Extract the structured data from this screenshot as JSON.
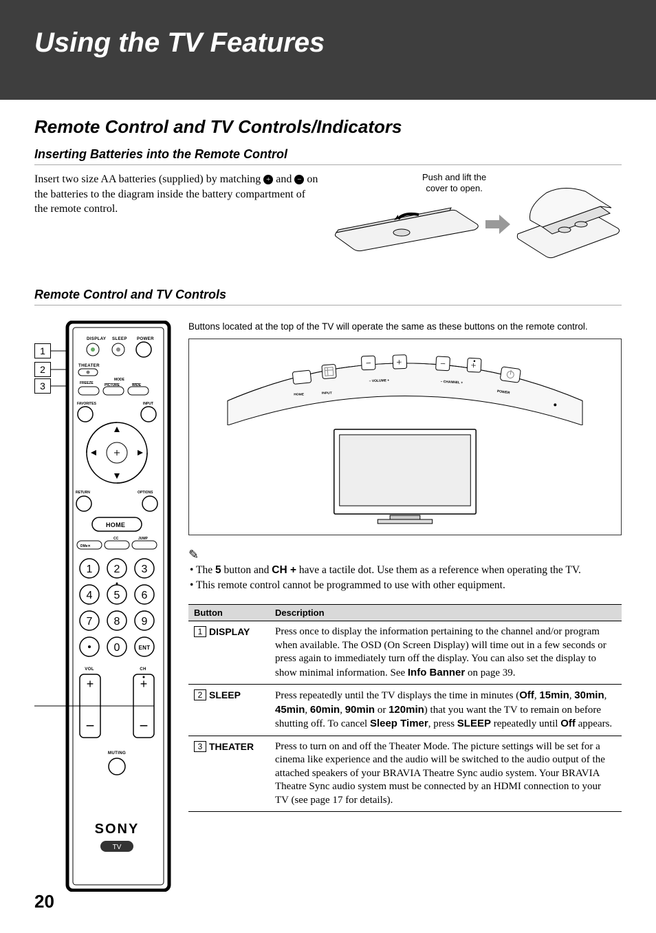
{
  "chapter_title": "Using the TV Features",
  "section_heading": "Remote Control and TV Controls/Indicators",
  "sub1_heading": "Inserting Batteries into the Remote Control",
  "intro_text_pre": "Insert two size AA batteries (supplied) by matching ",
  "intro_text_mid": " and ",
  "intro_text_post": " on the batteries to the diagram inside the battery compartment of the remote control.",
  "battery_caption_line1": "Push and lift the",
  "battery_caption_line2": "cover to open.",
  "sub2_heading": "Remote Control and TV Controls",
  "tv_note": "Buttons located at the top of the TV will operate the same as these buttons on the remote control.",
  "tv_labels": {
    "home": "HOME",
    "input": "INPUT",
    "volume": "– VOLUME +",
    "channel": "– CHANNEL +",
    "power": "POWER"
  },
  "note1_pre": "The ",
  "note1_b1": "5",
  "note1_mid": " button and ",
  "note1_b2": "CH +",
  "note1_post": " have a tactile dot. Use them as a reference when operating the TV.",
  "note2": "This remote control cannot be programmed to use with other equipment.",
  "table": {
    "header_button": "Button",
    "header_desc": "Description",
    "rows": [
      {
        "num": "1",
        "name": "DISPLAY",
        "desc_pre": "Press once to display the information pertaining to the channel and/or program when available. The OSD (On Screen Display) will time out in a few seconds or press again to immediately turn off the display. You can also set the display to show minimal information. See ",
        "desc_b1": "Info Banner",
        "desc_post": " on page 39."
      },
      {
        "num": "2",
        "name": "SLEEP",
        "desc_pre": "Press repeatedly until the TV displays the time in minutes (",
        "desc_b1": "Off",
        "s1": ", ",
        "desc_b2": "15min",
        "s2": ", ",
        "desc_b3": "30min",
        "s3": ", ",
        "desc_b4": "45min",
        "s4": ", ",
        "desc_b5": "60min",
        "s5": ", ",
        "desc_b6": "90min",
        "s6": " or ",
        "desc_b7": "120min",
        "desc_mid": ") that you want the TV to remain on before shutting off. To cancel ",
        "desc_b8": "Sleep Timer",
        "s7": ", press ",
        "desc_b9": "SLEEP",
        "s8": " repeatedly until ",
        "desc_b10": "Off",
        "desc_post": " appears."
      },
      {
        "num": "3",
        "name": "THEATER",
        "desc": "Press to turn on and off the Theater Mode. The picture settings will be set for a cinema like experience and the audio will be switched to the audio output of the attached speakers of your BRAVIA Theatre Sync audio system. Your BRAVIA Theatre Sync audio system must be connected by an HDMI connection to your TV (see page 17 for details)."
      }
    ]
  },
  "remote_labels": {
    "display": "DISPLAY",
    "sleep": "SLEEP",
    "power": "POWER",
    "theater": "THEATER",
    "freeze": "FREEZE",
    "mode": "MODE",
    "picture": "PICTURE",
    "wide": "WIDE",
    "favorites": "FAVORITES",
    "input": "INPUT",
    "return": "RETURN",
    "options": "OPTIONS",
    "home": "HOME",
    "dmex": "DMe✕",
    "cc": "CC",
    "jump": "JUMP",
    "vol": "VOL",
    "ch": "CH",
    "muting": "MUTING",
    "ent": "ENT",
    "brand": "SONY",
    "tv": "TV"
  },
  "callouts": {
    "c1": "1",
    "c2": "2",
    "c3": "3"
  },
  "page_number": "20"
}
